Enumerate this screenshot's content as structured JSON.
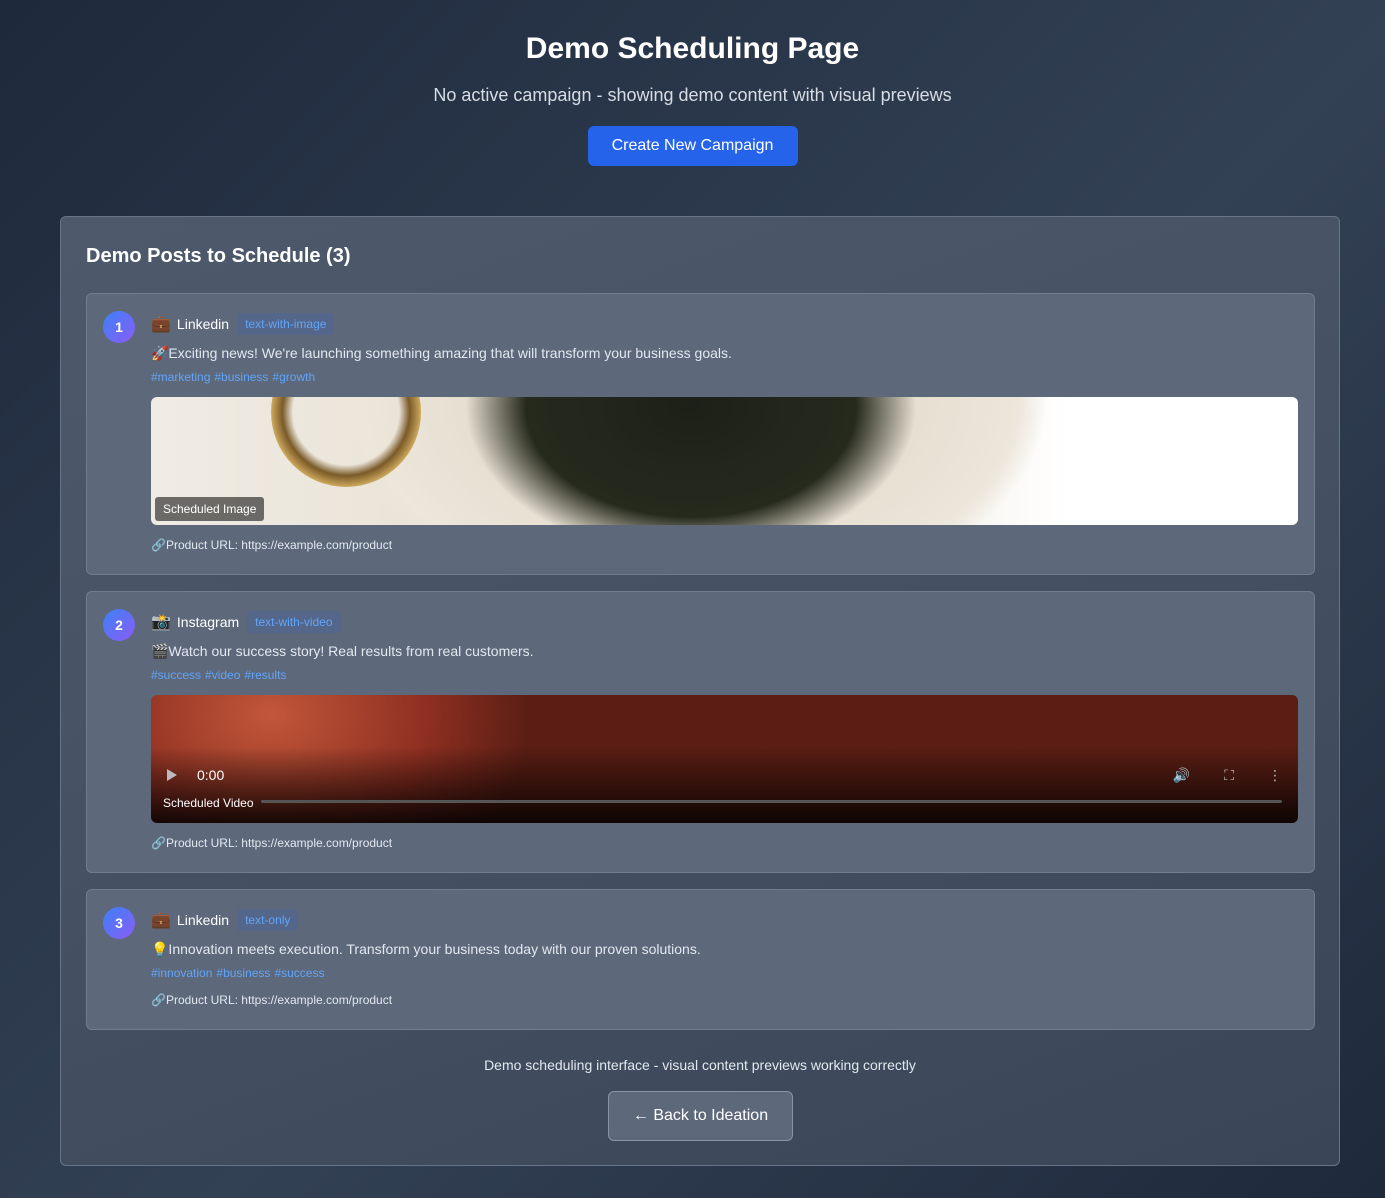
{
  "header": {
    "title": "Demo Scheduling Page",
    "subtitle": "No active campaign - showing demo content with visual previews",
    "create_button": "Create New Campaign"
  },
  "panel": {
    "title": "Demo Posts to Schedule (3)",
    "posts": [
      {
        "number": "1",
        "platform_icon": "💼",
        "platform": "Linkedin",
        "type": "text-with-image",
        "text": "🚀Exciting news! We're launching something amazing that will transform your business goals.",
        "hashtags": [
          "#marketing",
          "#business",
          "#growth"
        ],
        "media_label": "Scheduled Image",
        "product_url": "🔗Product URL: https://example.com/product"
      },
      {
        "number": "2",
        "platform_icon": "📸",
        "platform": "Instagram",
        "type": "text-with-video",
        "text": "🎬Watch our success story! Real results from real customers.",
        "hashtags": [
          "#success",
          "#video",
          "#results"
        ],
        "media_label": "Scheduled Video",
        "video_time": "0:00",
        "product_url": "🔗Product URL: https://example.com/product"
      },
      {
        "number": "3",
        "platform_icon": "💼",
        "platform": "Linkedin",
        "type": "text-only",
        "text": "💡Innovation meets execution. Transform your business today with our proven solutions.",
        "hashtags": [
          "#innovation",
          "#business",
          "#success"
        ],
        "product_url": "🔗Product URL: https://example.com/product"
      }
    ],
    "footer_note": "Demo scheduling interface - visual content previews working correctly",
    "back_button": "← Back to Ideation"
  }
}
